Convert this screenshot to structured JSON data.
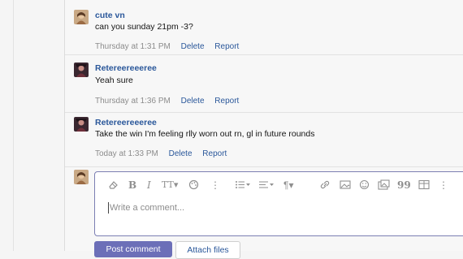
{
  "comments": [
    {
      "user": "cute vn",
      "message": "can you sunday 21pm -3?",
      "time": "Thursday at 1:31 PM",
      "delete_label": "Delete",
      "report_label": "Report",
      "avatar_icon": "user-avatar"
    },
    {
      "user": "Retereereeeree",
      "message": "Yeah sure",
      "time": "Thursday at 1:36 PM",
      "delete_label": "Delete",
      "report_label": "Report",
      "avatar_icon": "user-avatar"
    },
    {
      "user": "Retereereeeree",
      "message": "Take the win I'm feeling rlly worn out rn, gl in future rounds",
      "time": "Today at 1:33 PM",
      "delete_label": "Delete",
      "report_label": "Report",
      "avatar_icon": "user-avatar"
    }
  ],
  "editor": {
    "placeholder": "Write a comment...",
    "toolbar_icons": [
      "eraser-icon",
      "bold-icon",
      "italic-icon",
      "text-size-icon",
      "palette-icon",
      "more-icon",
      "list-icon",
      "align-icon",
      "paragraph-icon",
      "link-icon",
      "image-icon",
      "emoji-icon",
      "media-icon",
      "quote-icon",
      "table-icon",
      "more-icon"
    ],
    "text_size_label": "TT",
    "bold_label": "B",
    "italic_label": "I",
    "paragraph_label": "¶",
    "quote_label": "99"
  },
  "actions": {
    "post_label": "Post comment",
    "attach_label": "Attach files"
  },
  "colors": {
    "link": "#2a579a",
    "meta": "#8c8c8c",
    "editor_border": "#7c7fb3",
    "post_button": "#6c6fb8"
  }
}
